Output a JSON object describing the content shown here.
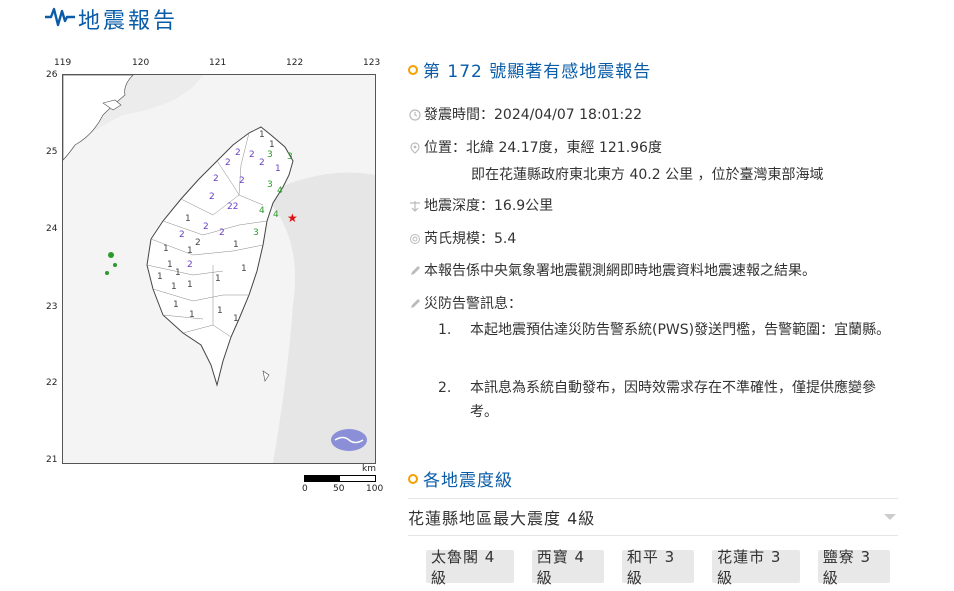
{
  "header": {
    "title": "地震報告",
    "icon": "seismograph-icon"
  },
  "map": {
    "lon_ticks": [
      "119",
      "120",
      "121",
      "122",
      "123"
    ],
    "lat_ticks": [
      "26",
      "25",
      "24",
      "23",
      "22",
      "21"
    ],
    "scale": {
      "unit": "km",
      "labels": [
        "0",
        "50",
        "100"
      ]
    },
    "epicenter_marker": "★",
    "intensity_labels": [
      {
        "v": "1",
        "c": "#444"
      },
      {
        "v": "2",
        "c": "#6a3fc8"
      },
      {
        "v": "3",
        "c": "#2a9a2a"
      },
      {
        "v": "4",
        "c": "#2a9a2a"
      }
    ],
    "colors": {
      "level1": "#444444",
      "level2": "#6a3fc8",
      "level3": "#2a9a2a",
      "epicenter": "#e01010",
      "sea": "#f4f4f4"
    }
  },
  "report": {
    "title": "第 172 號顯著有感地震報告",
    "time": "發震時間：2024/04/07 18:01:22",
    "location_line1": "位置：北緯 24.17度，東經 121.96度",
    "location_line2": "即在花蓮縣政府東北東方 40.2 公里 ，位於臺灣東部海域",
    "depth": "地震深度：16.9公里",
    "magnitude": "芮氏規模：5.4",
    "note": "本報告係中央氣象署地震觀測網即時地震資料地震速報之結果。",
    "warning_title": "災防告警訊息：",
    "warnings": [
      {
        "num": "1.",
        "text": "本起地震預估達災防告警系統(PWS)發送門檻，告警範圍：宜蘭縣。"
      },
      {
        "num": "2.",
        "text": "本訊息為系統自動發布，因時效需求存在不準確性，僅提供應變參考。"
      }
    ]
  },
  "intensity": {
    "section_title": "各地震度級",
    "dropdown_value": "花蓮縣地區最大震度 4級",
    "stations": [
      "太魯閣 4級",
      "西寶 4級",
      "和平 3級",
      "花蓮市 3級",
      "鹽寮 3級"
    ]
  },
  "accent": "#0a5ca8",
  "dot_color": "#f4a000"
}
